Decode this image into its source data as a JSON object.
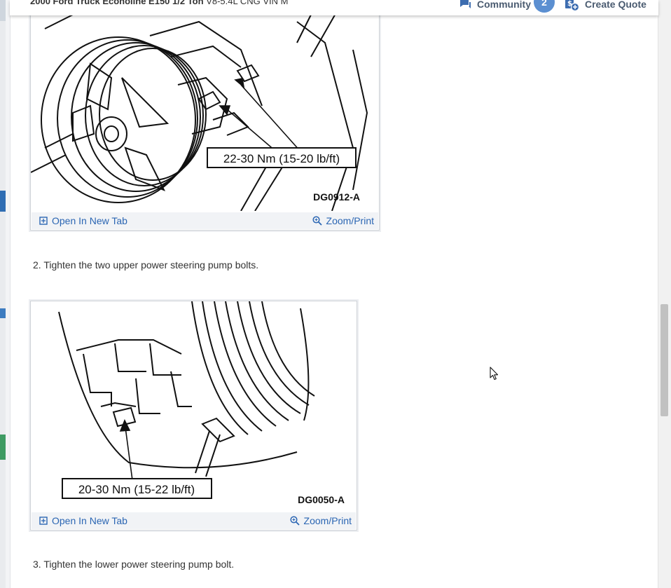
{
  "header": {
    "vehicle_bold": "2000 Ford Truck Econoline E150 1/2 Ton",
    "vehicle_rest": " V8-5.4L CNG VIN M",
    "community_label": "Community",
    "community_count": "2",
    "create_quote_label": "Create Quote"
  },
  "figures": [
    {
      "torque_label": "22-30 Nm (15-20 lb/ft)",
      "figure_code": "DG0912-A",
      "open_tab_label": "Open In New Tab",
      "zoom_label": "Zoom/Print"
    },
    {
      "torque_label": "20-30 Nm (15-22 lb/ft)",
      "figure_code": "DG0050-A",
      "open_tab_label": "Open In New Tab",
      "zoom_label": "Zoom/Print"
    }
  ],
  "steps": [
    "2. Tighten the two upper power steering pump bolts.",
    "3. Tighten the lower power steering pump bolt."
  ],
  "colors": {
    "link": "#2b66b3",
    "badge": "#5b8fd1",
    "header_text": "#4a5b70"
  },
  "icons": [
    "community-chat-icon",
    "create-quote-icon",
    "open-tab-icon",
    "zoom-icon",
    "mouse-cursor-icon"
  ]
}
